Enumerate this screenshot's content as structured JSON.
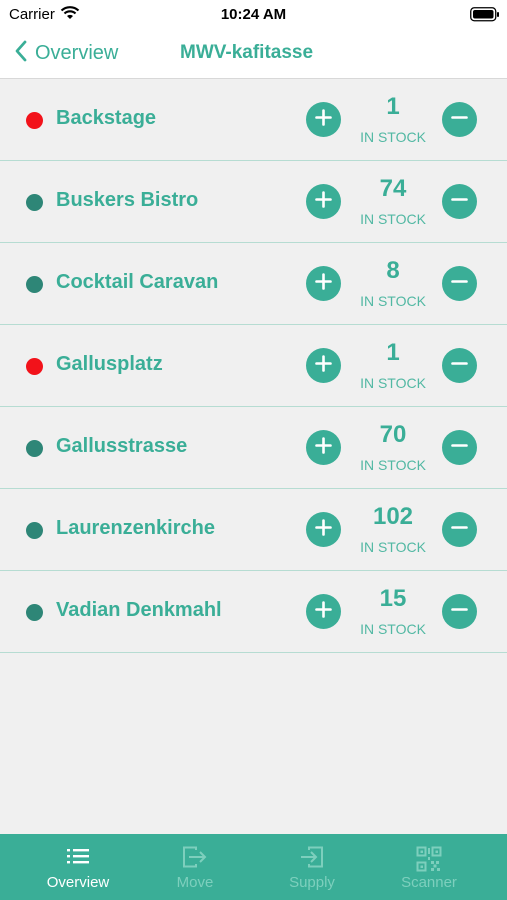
{
  "status_bar": {
    "carrier": "Carrier",
    "time": "10:24 AM"
  },
  "nav": {
    "back_label": "Overview",
    "title": "MWV-kafitasse"
  },
  "locations": [
    {
      "name": "Backstage",
      "count": "1",
      "stock_label": "IN STOCK",
      "status": "low"
    },
    {
      "name": "Buskers Bistro",
      "count": "74",
      "stock_label": "IN STOCK",
      "status": "ok"
    },
    {
      "name": "Cocktail Caravan",
      "count": "8",
      "stock_label": "IN STOCK",
      "status": "ok"
    },
    {
      "name": "Gallusplatz",
      "count": "1",
      "stock_label": "IN STOCK",
      "status": "low"
    },
    {
      "name": "Gallusstrasse",
      "count": "70",
      "stock_label": "IN STOCK",
      "status": "ok"
    },
    {
      "name": "Laurenzenkirche",
      "count": "102",
      "stock_label": "IN STOCK",
      "status": "ok"
    },
    {
      "name": "Vadian Denkmahl",
      "count": "15",
      "stock_label": "IN STOCK",
      "status": "ok"
    }
  ],
  "tabs": [
    {
      "label": "Overview",
      "icon": "list-icon",
      "active": true
    },
    {
      "label": "Move",
      "icon": "move-icon",
      "active": false
    },
    {
      "label": "Supply",
      "icon": "supply-icon",
      "active": false
    },
    {
      "label": "Scanner",
      "icon": "qr-icon",
      "active": false
    }
  ],
  "colors": {
    "accent": "#3aae97",
    "status_low": "#f2121a",
    "status_ok": "#2e8677",
    "tab_inactive": "#7dcfbd"
  }
}
